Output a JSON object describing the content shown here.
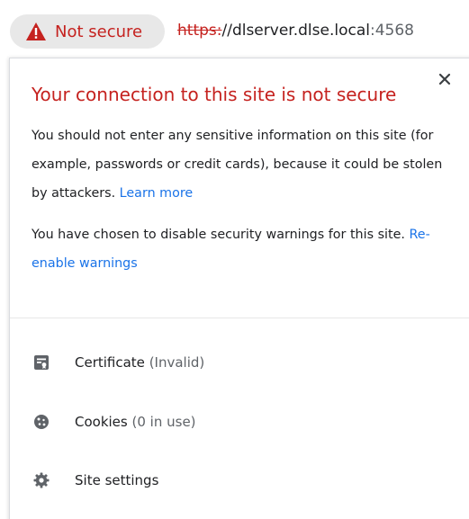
{
  "omnibox": {
    "security_label": "Not secure",
    "url_scheme": "https:",
    "url_rest": "//dlserver.dlse.local",
    "url_port": ":4568"
  },
  "bubble": {
    "title": "Your connection to this site is not secure",
    "paragraph1": "You should not enter any sensitive information on this site (for example, passwords or credit cards), because it could be stolen by attackers.",
    "learn_more": "Learn more",
    "paragraph2": "You have chosen to disable security warnings for this site.",
    "reenable": "Re-enable warnings",
    "items": [
      {
        "label": "Certificate",
        "sub": "(Invalid)",
        "icon": "certificate-icon"
      },
      {
        "label": "Cookies",
        "sub": "(0 in use)",
        "icon": "cookie-icon"
      },
      {
        "label": "Site settings",
        "sub": "",
        "icon": "gear-icon"
      }
    ]
  },
  "colors": {
    "danger": "#c5221f",
    "link": "#1a73e8",
    "chip_bg": "#e8e8e8",
    "icon": "#5f6368"
  }
}
